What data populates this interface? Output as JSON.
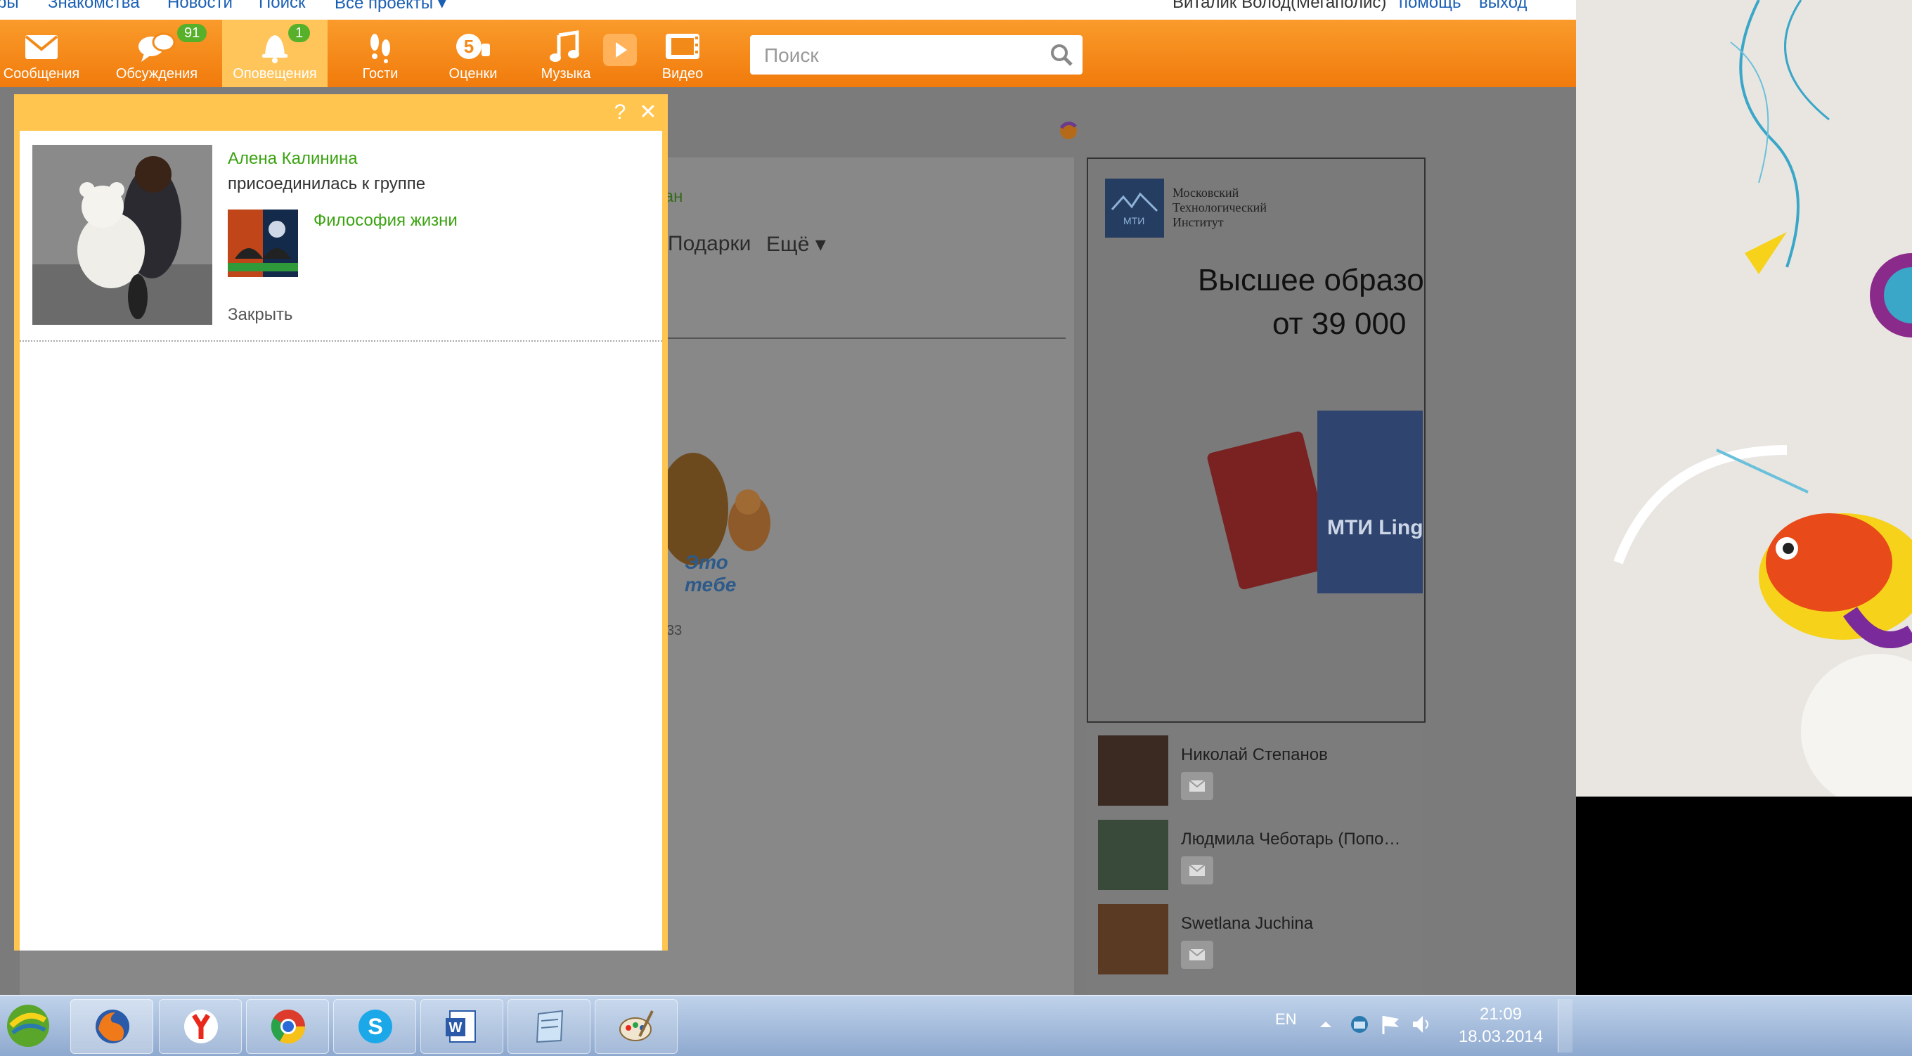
{
  "top_nav": {
    "links": [
      "ры",
      "Знакомства",
      "Новости",
      "Поиск",
      "Все проекты ▾"
    ],
    "user_name": "Виталик Волод(Мегаполис)",
    "help": "помощь",
    "logout": "выход"
  },
  "toolbar": {
    "items": [
      {
        "label": "Сообщения",
        "icon": "envelope-icon"
      },
      {
        "label": "Обсуждения",
        "icon": "chat-bubbles-icon",
        "badge": "91"
      },
      {
        "label": "Оповещения",
        "icon": "bell-icon",
        "badge": "1",
        "active": true
      },
      {
        "label": "Гости",
        "icon": "footprints-icon"
      },
      {
        "label": "Оценки",
        "icon": "rating-5-icon"
      },
      {
        "label": "Музыка",
        "icon": "music-note-icon"
      },
      {
        "label": "Видео",
        "icon": "film-icon"
      }
    ],
    "search_placeholder": "Поиск"
  },
  "background_page": {
    "menu_more": "Ещё ▾",
    "menu_gifts": "Подарки",
    "partial_link": "тан",
    "sticker_text": "Это тебе",
    "ad": {
      "brand_line1": "Московский",
      "brand_line2": "Технологический",
      "brand_line3": "Институт",
      "logo_text": "МТИ",
      "headline1": "Высшее образов",
      "headline2": "от  39 000",
      "product_label": "МТИ Ling"
    },
    "people": [
      {
        "name": "Николай Степанов"
      },
      {
        "name": "Людмила Чеботарь (Попо…"
      },
      {
        "name": "Swetlana Juchina"
      }
    ]
  },
  "notification_popup": {
    "help_btn": "?",
    "close_btn": "✕",
    "user_name": "Алена Калинина",
    "action_text": "присоединилась к группе",
    "group_name": "Философия жизни",
    "close_link": "Закрыть"
  },
  "taskbar": {
    "apps": [
      "start-orb-icon",
      "firefox-icon",
      "yandex-browser-icon",
      "chrome-icon",
      "skype-icon",
      "word-icon",
      "notepad-icon",
      "paint-icon"
    ],
    "language": "EN",
    "time": "21:09",
    "date": "18.03.2014"
  },
  "colors": {
    "toolbar_orange": "#f28a1a",
    "popup_yellow": "#ffc54f",
    "link_green": "#3aa311",
    "badge_green": "#56b02a"
  }
}
